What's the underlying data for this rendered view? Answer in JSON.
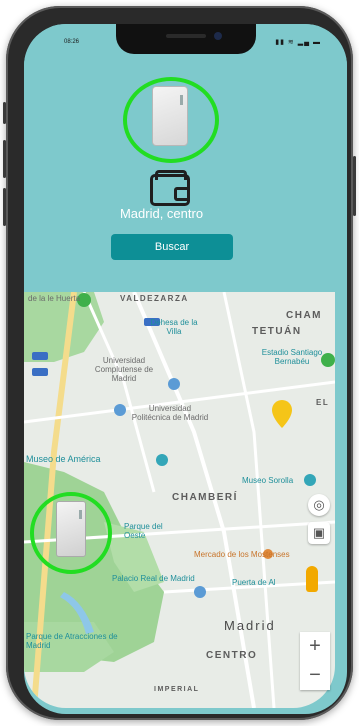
{
  "status_bar": {
    "time": "08:26",
    "icons": "▮▮ ≋ ▂▄ ▬"
  },
  "header": {
    "location_label": "Madrid, centro",
    "search_button_label": "Buscar"
  },
  "map": {
    "labels": {
      "valdezarza": "VALDEZARZA",
      "chamartin_partial": "CHAM",
      "tetuan": "TETUÁN",
      "dehesa": "Dehesa de la Villa",
      "bernabeu": "Estadio Santiago Bernabéu",
      "ucm": "Universidad Complutense de Madrid",
      "upm": "Universidad Politécnica de Madrid",
      "museo_america": "Museo de América",
      "museo_sorolla": "Museo Sorolla",
      "chamberi": "CHAMBERÍ",
      "parque_oeste": "Parque del Oeste",
      "mercado": "Mercado de los Mostenses",
      "palacio": "Palacio Real de Madrid",
      "puerta": "Puerta de Al",
      "madrid": "Madrid",
      "centro": "CENTRO",
      "parque_atracciones": "Parque de Atracciones de Madrid",
      "imperial": "IMPERIAL",
      "top_left": "de la le Huerta",
      "el_partial": "EL"
    },
    "controls": {
      "locate": "◎",
      "transit": "▣",
      "zoom_in": "+",
      "zoom_out": "−"
    }
  },
  "colors": {
    "header_bg": "#7ec9cc",
    "button_bg": "#0d8f96",
    "highlight_ring": "#22dd22",
    "map_bg": "#e8ece7",
    "park_green": "#a8d8a0"
  }
}
